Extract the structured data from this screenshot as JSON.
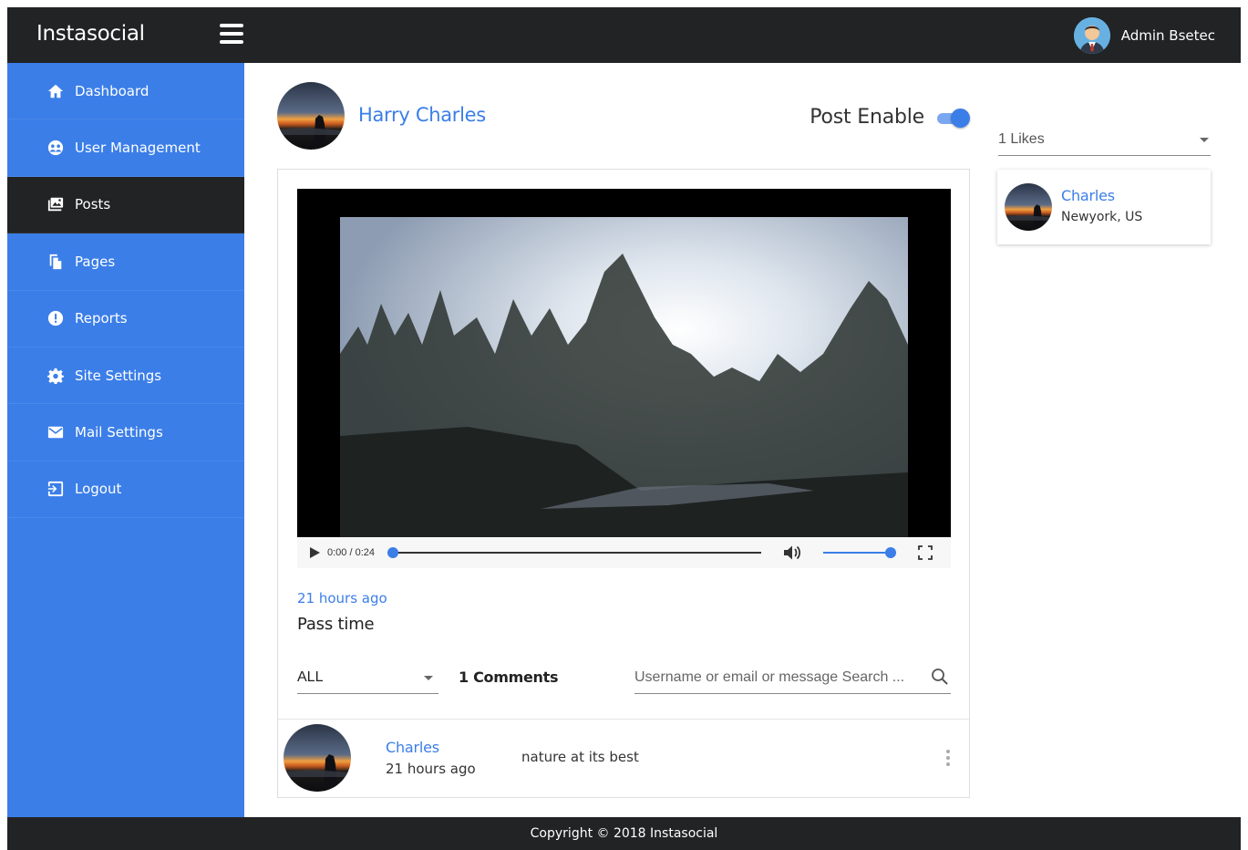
{
  "app": {
    "brand": "Instasocial"
  },
  "header": {
    "admin_name": "Admin Bsetec"
  },
  "sidebar": {
    "items": [
      {
        "label": "Dashboard",
        "icon": "home-icon"
      },
      {
        "label": "User Management",
        "icon": "users-icon"
      },
      {
        "label": "Posts",
        "icon": "image-gallery-icon"
      },
      {
        "label": "Pages",
        "icon": "pages-icon"
      },
      {
        "label": "Reports",
        "icon": "alert-icon"
      },
      {
        "label": "Site Settings",
        "icon": "gear-icon"
      },
      {
        "label": "Mail Settings",
        "icon": "mail-icon"
      },
      {
        "label": "Logout",
        "icon": "logout-icon"
      }
    ],
    "active_index": 2
  },
  "post": {
    "author": "Harry Charles",
    "enable_label": "Post Enable",
    "enabled": true,
    "time_ago": "21 hours ago",
    "caption": "Pass time",
    "video": {
      "current": "0:00",
      "duration": "0:24",
      "time_display": "0:00 / 0:24",
      "progress": 0,
      "volume": 1
    }
  },
  "comments": {
    "filter_value": "ALL",
    "count_label": "1 Comments",
    "search_placeholder": "Username or email or message Search ...",
    "items": [
      {
        "user": "Charles",
        "time_ago": "21 hours ago",
        "text": "nature at its best"
      }
    ]
  },
  "likes": {
    "select_value": "1 Likes",
    "items": [
      {
        "name": "Charles",
        "location": "Newyork, US"
      }
    ]
  },
  "footer": {
    "copyright": "Copyright © 2018 Instasocial"
  },
  "colors": {
    "accent": "#3b7ee8",
    "dark": "#222324",
    "sidebar": "#3b7ee8"
  }
}
